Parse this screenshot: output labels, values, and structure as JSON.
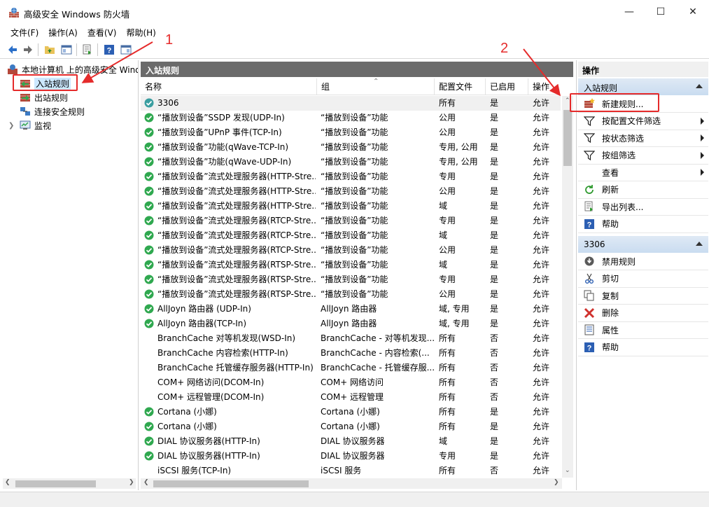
{
  "window": {
    "title": "高级安全 Windows 防火墙",
    "minimize_glyph": "—",
    "maximize_glyph": "☐",
    "close_glyph": "✕"
  },
  "menu": [
    "文件(F)",
    "操作(A)",
    "查看(V)",
    "帮助(H)"
  ],
  "toolbar_icons": [
    "back-arrow-icon",
    "forward-arrow-icon",
    "up-folder-icon",
    "show-hide-tree-icon",
    "export-list-icon",
    "help-icon",
    "action-pane-icon"
  ],
  "tree": {
    "root": "本地计算机 上的高级安全 Windows",
    "items": [
      {
        "label": "入站规则",
        "selected": true
      },
      {
        "label": "出站规则",
        "selected": false
      },
      {
        "label": "连接安全规则",
        "selected": false
      },
      {
        "label": "监视",
        "selected": false,
        "expandable": true
      }
    ]
  },
  "center": {
    "header": "入站规则",
    "columns": [
      "名称",
      "组",
      "配置文件",
      "已启用",
      "操作"
    ],
    "rows": [
      {
        "enabled_icon": "custom",
        "name": "3306",
        "group": "",
        "profile": "所有",
        "enabled": "是",
        "action": "允许"
      },
      {
        "enabled_icon": "check",
        "name": "“播放到设备”SSDP 发现(UDP-In)",
        "group": "“播放到设备”功能",
        "profile": "公用",
        "enabled": "是",
        "action": "允许"
      },
      {
        "enabled_icon": "check",
        "name": "“播放到设备”UPnP 事件(TCP-In)",
        "group": "“播放到设备”功能",
        "profile": "公用",
        "enabled": "是",
        "action": "允许"
      },
      {
        "enabled_icon": "check",
        "name": "“播放到设备”功能(qWave-TCP-In)",
        "group": "“播放到设备”功能",
        "profile": "专用, 公用",
        "enabled": "是",
        "action": "允许"
      },
      {
        "enabled_icon": "check",
        "name": "“播放到设备”功能(qWave-UDP-In)",
        "group": "“播放到设备”功能",
        "profile": "专用, 公用",
        "enabled": "是",
        "action": "允许"
      },
      {
        "enabled_icon": "check",
        "name": "“播放到设备”流式处理服务器(HTTP-Stre...",
        "group": "“播放到设备”功能",
        "profile": "专用",
        "enabled": "是",
        "action": "允许"
      },
      {
        "enabled_icon": "check",
        "name": "“播放到设备”流式处理服务器(HTTP-Stre...",
        "group": "“播放到设备”功能",
        "profile": "公用",
        "enabled": "是",
        "action": "允许"
      },
      {
        "enabled_icon": "check",
        "name": "“播放到设备”流式处理服务器(HTTP-Stre...",
        "group": "“播放到设备”功能",
        "profile": "域",
        "enabled": "是",
        "action": "允许"
      },
      {
        "enabled_icon": "check",
        "name": "“播放到设备”流式处理服务器(RTCP-Stre...",
        "group": "“播放到设备”功能",
        "profile": "专用",
        "enabled": "是",
        "action": "允许"
      },
      {
        "enabled_icon": "check",
        "name": "“播放到设备”流式处理服务器(RTCP-Stre...",
        "group": "“播放到设备”功能",
        "profile": "域",
        "enabled": "是",
        "action": "允许"
      },
      {
        "enabled_icon": "check",
        "name": "“播放到设备”流式处理服务器(RTCP-Stre...",
        "group": "“播放到设备”功能",
        "profile": "公用",
        "enabled": "是",
        "action": "允许"
      },
      {
        "enabled_icon": "check",
        "name": "“播放到设备”流式处理服务器(RTSP-Stre...",
        "group": "“播放到设备”功能",
        "profile": "域",
        "enabled": "是",
        "action": "允许"
      },
      {
        "enabled_icon": "check",
        "name": "“播放到设备”流式处理服务器(RTSP-Stre...",
        "group": "“播放到设备”功能",
        "profile": "专用",
        "enabled": "是",
        "action": "允许"
      },
      {
        "enabled_icon": "check",
        "name": "“播放到设备”流式处理服务器(RTSP-Stre...",
        "group": "“播放到设备”功能",
        "profile": "公用",
        "enabled": "是",
        "action": "允许"
      },
      {
        "enabled_icon": "check",
        "name": "AllJoyn 路由器 (UDP-In)",
        "group": "AllJoyn 路由器",
        "profile": "域, 专用",
        "enabled": "是",
        "action": "允许"
      },
      {
        "enabled_icon": "check",
        "name": "AllJoyn 路由器(TCP-In)",
        "group": "AllJoyn 路由器",
        "profile": "域, 专用",
        "enabled": "是",
        "action": "允许"
      },
      {
        "enabled_icon": "none",
        "name": "BranchCache 对等机发现(WSD-In)",
        "group": "BranchCache - 对等机发现...",
        "profile": "所有",
        "enabled": "否",
        "action": "允许"
      },
      {
        "enabled_icon": "none",
        "name": "BranchCache 内容检索(HTTP-In)",
        "group": "BranchCache - 内容检索(...",
        "profile": "所有",
        "enabled": "否",
        "action": "允许"
      },
      {
        "enabled_icon": "none",
        "name": "BranchCache 托管缓存服务器(HTTP-In)",
        "group": "BranchCache - 托管缓存服...",
        "profile": "所有",
        "enabled": "否",
        "action": "允许"
      },
      {
        "enabled_icon": "none",
        "name": "COM+ 网络访问(DCOM-In)",
        "group": "COM+ 网络访问",
        "profile": "所有",
        "enabled": "否",
        "action": "允许"
      },
      {
        "enabled_icon": "none",
        "name": "COM+ 远程管理(DCOM-In)",
        "group": "COM+ 远程管理",
        "profile": "所有",
        "enabled": "否",
        "action": "允许"
      },
      {
        "enabled_icon": "check",
        "name": "Cortana (小娜)",
        "group": "Cortana (小娜)",
        "profile": "所有",
        "enabled": "是",
        "action": "允许"
      },
      {
        "enabled_icon": "check",
        "name": "Cortana (小娜)",
        "group": "Cortana (小娜)",
        "profile": "所有",
        "enabled": "是",
        "action": "允许"
      },
      {
        "enabled_icon": "check",
        "name": "DIAL 协议服务器(HTTP-In)",
        "group": "DIAL 协议服务器",
        "profile": "域",
        "enabled": "是",
        "action": "允许"
      },
      {
        "enabled_icon": "check",
        "name": "DIAL 协议服务器(HTTP-In)",
        "group": "DIAL 协议服务器",
        "profile": "专用",
        "enabled": "是",
        "action": "允许"
      },
      {
        "enabled_icon": "none",
        "name": "iSCSI 服务(TCP-In)",
        "group": "iSCSI 服务",
        "profile": "所有",
        "enabled": "否",
        "action": "允许"
      }
    ]
  },
  "actions_pane": {
    "title": "操作",
    "sections": [
      {
        "title": "入站规则",
        "items": [
          {
            "label": "新建规则...",
            "icon": "new-rule-icon",
            "submenu": false
          },
          {
            "label": "按配置文件筛选",
            "icon": "filter-icon",
            "submenu": true
          },
          {
            "label": "按状态筛选",
            "icon": "filter-icon",
            "submenu": true
          },
          {
            "label": "按组筛选",
            "icon": "filter-icon",
            "submenu": true
          },
          {
            "label": "查看",
            "icon": "none",
            "submenu": true
          },
          {
            "label": "刷新",
            "icon": "refresh-icon",
            "submenu": false
          },
          {
            "label": "导出列表...",
            "icon": "export-list-icon",
            "submenu": false
          },
          {
            "label": "帮助",
            "icon": "help-icon",
            "submenu": false
          }
        ]
      },
      {
        "title": "3306",
        "items": [
          {
            "label": "禁用规则",
            "icon": "disable-rule-icon",
            "submenu": false
          },
          {
            "label": "剪切",
            "icon": "cut-icon",
            "submenu": false
          },
          {
            "label": "复制",
            "icon": "copy-icon",
            "submenu": false
          },
          {
            "label": "删除",
            "icon": "delete-icon",
            "submenu": false
          },
          {
            "label": "属性",
            "icon": "properties-icon",
            "submenu": false
          },
          {
            "label": "帮助",
            "icon": "help-icon",
            "submenu": false
          }
        ]
      }
    ]
  },
  "annotations": {
    "step1": "1",
    "step2": "2",
    "color": "#e52b2b"
  },
  "colors": {
    "header_bg": "#6b6b6b",
    "section_bg": "#c9dcf0",
    "selection": "#cce8ff",
    "check_green": "#2fa84f"
  }
}
